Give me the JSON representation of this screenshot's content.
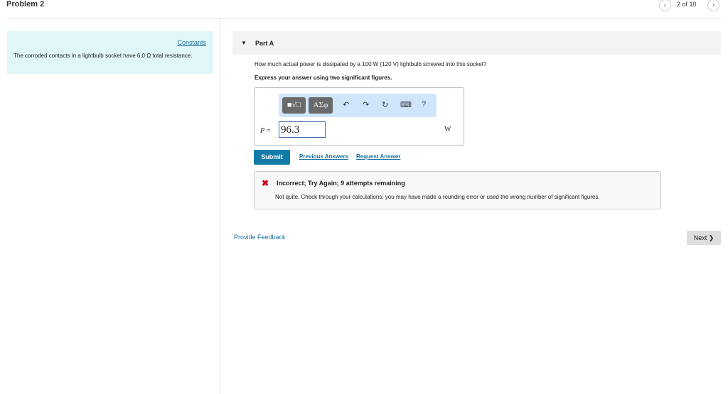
{
  "header": {
    "title": "Problem 2",
    "pager": "2 of 10",
    "prev_icon": "‹",
    "next_icon": "›"
  },
  "left_panel": {
    "constants_link": "Constants",
    "context": "The corroded contacts in a lightbulb socket have 6.0  Ω total resistance."
  },
  "part": {
    "label": "Part A",
    "question": "How much actual power is dissipated by a 100  W (120 V) lightbulb screwed into this socket?",
    "instruction": "Express your answer using two significant figures."
  },
  "toolbar": {
    "template_label": "■√□",
    "greek_label": "ΑΣφ",
    "undo": "↶",
    "redo": "↷",
    "reset": "↻",
    "keyboard": "⌨",
    "help": "?"
  },
  "answer": {
    "variable": "P =",
    "value": "96.3",
    "unit": "W"
  },
  "actions": {
    "submit": "Submit",
    "previous_answers": "Previous Answers",
    "request_answer": "Request Answer"
  },
  "feedback": {
    "icon": "✖",
    "title": "Incorrect; Try Again; 9 attempts remaining",
    "message": "Not quite. Check through your calculations; you may have made a rounding error or used the wrong number of significant figures."
  },
  "footer": {
    "provide_feedback": "Provide Feedback",
    "next": "Next ❯"
  }
}
